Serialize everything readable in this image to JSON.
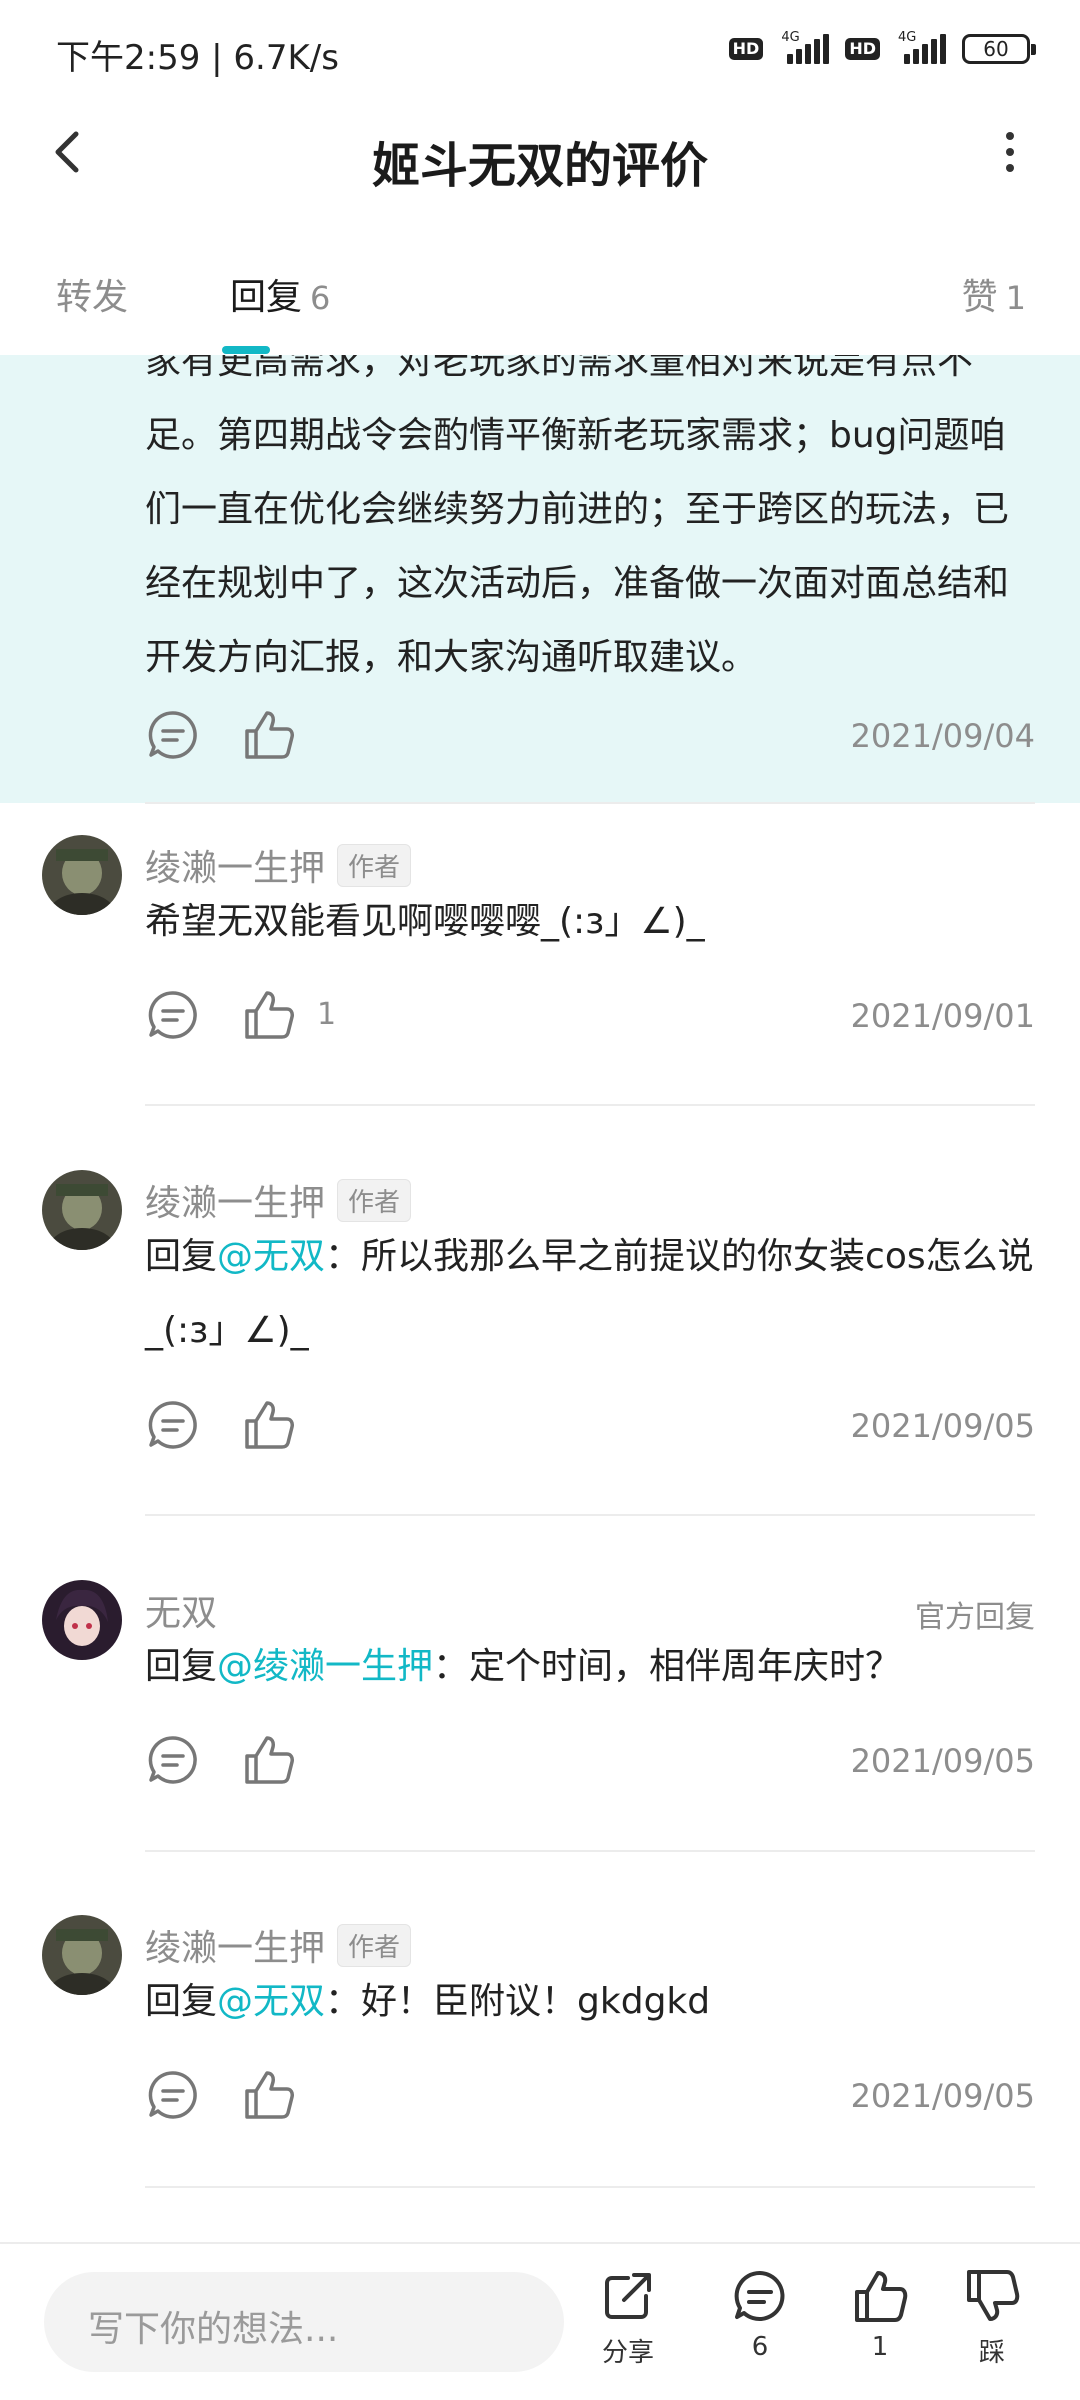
{
  "status_bar": {
    "time": "下午2:59 | 6.7K/s",
    "hd": "HD",
    "network": "4G",
    "battery": "60"
  },
  "header": {
    "title": "姬斗无双的评价"
  },
  "tabs": {
    "forward": "转发",
    "reply": "回复",
    "reply_count": "6",
    "like": "赞",
    "like_count": "1"
  },
  "highlight": {
    "text": "家有更高需求，对老玩家的需求量相对来说是有点不足。第四期战令会酌情平衡新老玩家需求；bug问题咱们一直在优化会继续努力前进的；至于跨区的玩法，已经在规划中了，这次活动后，准备做一次面对面总结和开发方向汇报，和大家沟通听取建议。",
    "date": "2021/09/04"
  },
  "comments": [
    {
      "name": "绫濑一生押",
      "badge": "作者",
      "text": "希望无双能看见啊嘤嘤嘤_(:з」∠)_",
      "like_count": "1",
      "date": "2021/09/01"
    },
    {
      "name": "绫濑一生押",
      "badge": "作者",
      "prefix": "回复",
      "mention": "@无双",
      "text": "：所以我那么早之前提议的你女装cos怎么说_(:з」∠)_",
      "date": "2021/09/05"
    },
    {
      "name": "无双",
      "official": "官方回复",
      "prefix": "回复",
      "mention": "@绫濑一生押",
      "text": "：定个时间，相伴周年庆时？",
      "date": "2021/09/05"
    },
    {
      "name": "绫濑一生押",
      "badge": "作者",
      "prefix": "回复",
      "mention": "@无双",
      "text": "：好！臣附议！gkdgkd",
      "date": "2021/09/05"
    }
  ],
  "bottom_bar": {
    "placeholder": "写下你的想法...",
    "share": "分享",
    "comment_count": "6",
    "like_count": "1",
    "dislike": "踩"
  },
  "colors": {
    "accent": "#12b8c6",
    "highlight_bg": "#e6f7f7",
    "muted": "#8d8d8d"
  }
}
